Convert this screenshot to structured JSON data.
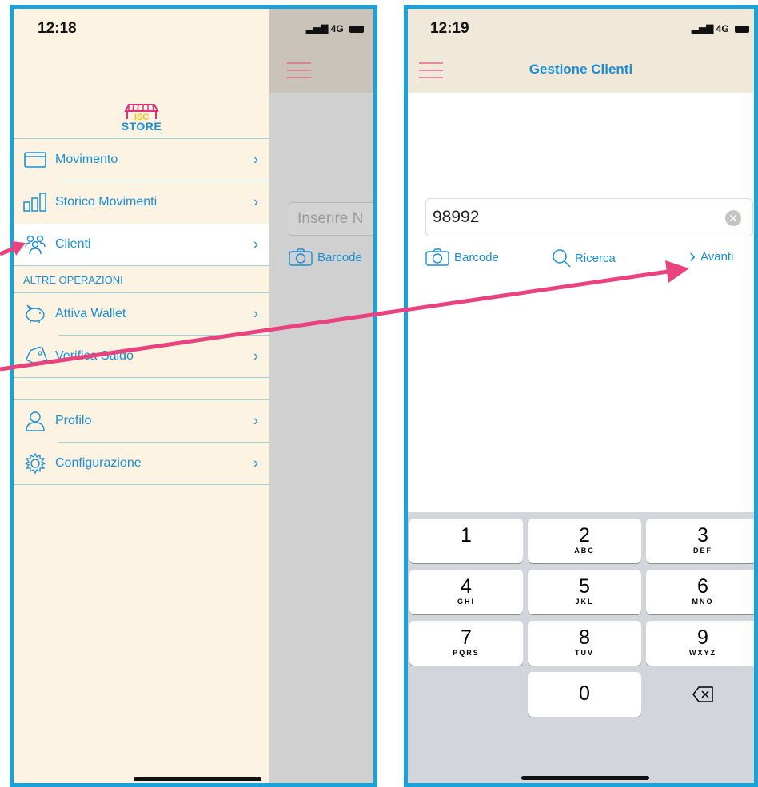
{
  "left_screen": {
    "time": "12:18",
    "network": "4G",
    "logo": {
      "isc": "ISC",
      "store": "STORE"
    },
    "menu": [
      {
        "label": "Movimento",
        "icon": "credit-card-icon"
      },
      {
        "label": "Storico Movimenti",
        "icon": "bar-chart-icon"
      },
      {
        "label": "Clienti",
        "icon": "users-icon",
        "active": true
      }
    ],
    "section_header": "ALTRE OPERAZIONI",
    "menu_extra": [
      {
        "label": "Attiva Wallet",
        "icon": "piggy-bank-icon"
      },
      {
        "label": "Verifica Saldo",
        "icon": "tag-icon"
      }
    ],
    "menu_bottom": [
      {
        "label": "Profilo",
        "icon": "user-icon"
      },
      {
        "label": "Configurazione",
        "icon": "gear-icon"
      }
    ],
    "background_input_placeholder": "Inserire N",
    "background_barcode_label": "Barcode"
  },
  "right_screen": {
    "time": "12:19",
    "network": "4G",
    "title": "Gestione Clienti",
    "search_value": "98992",
    "actions": {
      "barcode": "Barcode",
      "ricerca": "Ricerca",
      "avanti": "Avanti"
    },
    "keypad": [
      {
        "num": "1",
        "letters": ""
      },
      {
        "num": "2",
        "letters": "ABC"
      },
      {
        "num": "3",
        "letters": "DEF"
      },
      {
        "num": "4",
        "letters": "GHI"
      },
      {
        "num": "5",
        "letters": "JKL"
      },
      {
        "num": "6",
        "letters": "MNO"
      },
      {
        "num": "7",
        "letters": "PQRS"
      },
      {
        "num": "8",
        "letters": "TUV"
      },
      {
        "num": "9",
        "letters": "WXYZ"
      },
      {
        "num": "0",
        "letters": ""
      }
    ]
  },
  "colors": {
    "accent": "#1aa3d9",
    "arrow": "#e8437f"
  }
}
